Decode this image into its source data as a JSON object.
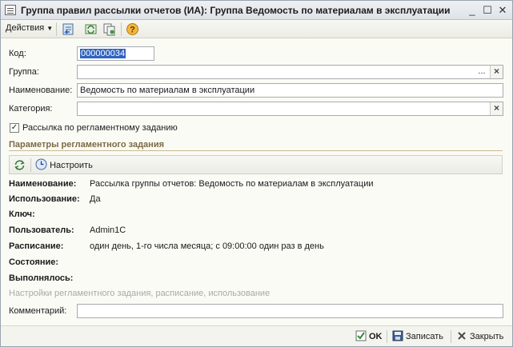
{
  "window": {
    "title": "Группа правил рассылки отчетов (ИА): Группа Ведомость по материалам в эксплуатации",
    "minimize_glyph": "_",
    "maximize_glyph": "☐",
    "close_glyph": "✕"
  },
  "toolbar": {
    "actions_label": "Действия",
    "icons": [
      "save-close-icon",
      "refresh-icon",
      "copy-icon",
      "help-icon"
    ]
  },
  "form": {
    "code_label": "Код:",
    "code_value": "000000034",
    "group_label": "Группа:",
    "group_value": "",
    "name_label": "Наименование:",
    "name_value": "Ведомость по материалам в эксплуатации",
    "category_label": "Категория:",
    "category_value": "",
    "mailing_checkbox_label": "Рассылка по регламентному заданию",
    "mailing_checked": true,
    "select_button": "...",
    "clear_glyph": "×"
  },
  "schedule_section": {
    "title": "Параметры регламентного задания",
    "configure_label": "Настроить",
    "rows": [
      {
        "label": "Наименование:",
        "value": "Рассылка группы отчетов: Ведомость по материалам в эксплуатации"
      },
      {
        "label": "Использование:",
        "value": "Да"
      },
      {
        "label": "Ключ:",
        "value": ""
      },
      {
        "label": "Пользователь:",
        "value": "Admin1C"
      },
      {
        "label": "Расписание:",
        "value": "один день, 1-го числа месяца; с 09:00:00 один раз в день"
      },
      {
        "label": "Состояние:",
        "value": ""
      },
      {
        "label": "Выполнялось:",
        "value": ""
      }
    ],
    "hint": "Настройки регламентного задания, расписание, использование"
  },
  "comment": {
    "label": "Комментарий:",
    "value": ""
  },
  "footer": {
    "ok_label": "OK",
    "save_label": "Записать",
    "close_label": "Закрыть"
  },
  "colors": {
    "section_title": "#7b6a43",
    "selection": "#2f63c1"
  }
}
